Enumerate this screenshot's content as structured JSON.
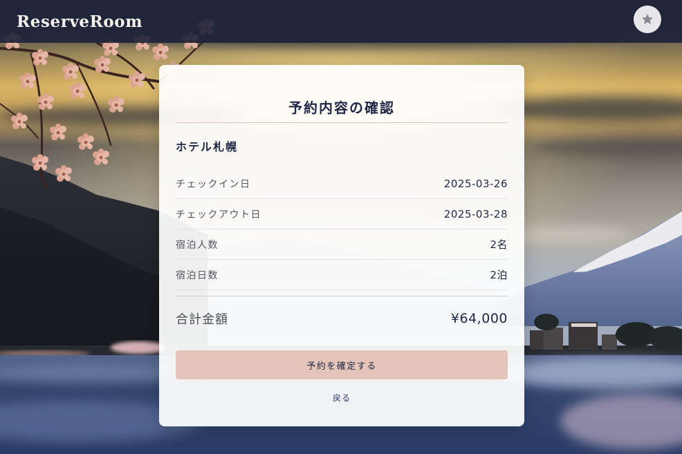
{
  "app": {
    "title": "ReserveRoom"
  },
  "header": {
    "favorite_icon": "star-icon"
  },
  "confirmation": {
    "title": "予約内容の確認",
    "hotel_name": "ホテル札幌",
    "rows": [
      {
        "label": "チェックイン日",
        "value": "2025-03-26"
      },
      {
        "label": "チェックアウト日",
        "value": "2025-03-28"
      },
      {
        "label": "宿泊人数",
        "value": "2名"
      },
      {
        "label": "宿泊日数",
        "value": "2泊"
      }
    ],
    "total": {
      "label": "合計金額",
      "value": "¥64,000"
    },
    "confirm_button": "予約を確定する",
    "back_link": "戻る"
  },
  "colors": {
    "navy": "#1e2745",
    "accent": "#e5c4b9",
    "divider": "#efbdb1"
  }
}
